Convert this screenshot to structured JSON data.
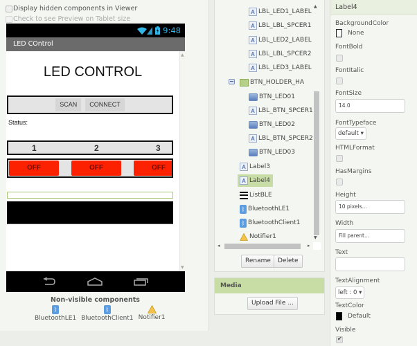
{
  "viewer": {
    "options": [
      {
        "label": "Display hidden components in Viewer",
        "checked": false,
        "enabled": true
      },
      {
        "label": "Check to see Preview on Tablet size",
        "checked": false,
        "enabled": false
      }
    ],
    "status_bar": {
      "time": "9:48",
      "icons": [
        "wifi-icon",
        "signal-icon",
        "battery-icon"
      ]
    },
    "screen_title": "LED COntrol",
    "app": {
      "title_label": "LED CONTROL",
      "scan_button": "SCAN",
      "connect_button": "CONNECT",
      "status_label": "Status:",
      "led_numbers": [
        "1",
        "2",
        "3"
      ],
      "led_buttons": [
        "OFF",
        "OFF",
        "OFF"
      ],
      "led_button_color": "#fc2100"
    },
    "nav_buttons": [
      "back-icon",
      "home-icon",
      "recents-icon"
    ],
    "non_visible": {
      "title": "Non-visible components",
      "items": [
        {
          "label": "BluetoothLE1",
          "icon": "bluetooth-icon"
        },
        {
          "label": "BluetoothClient1",
          "icon": "bluetooth-icon"
        },
        {
          "label": "Notifier1",
          "icon": "warning-icon"
        }
      ]
    }
  },
  "tree": {
    "items": [
      {
        "label": "LBL_LED1_LABEL",
        "icon": "label-icon"
      },
      {
        "label": "LBL_LBL_SPCER1",
        "icon": "label-icon"
      },
      {
        "label": "LBL_LED2_LABEL",
        "icon": "label-icon"
      },
      {
        "label": "LBL_LBL_SPCER2",
        "icon": "label-icon"
      },
      {
        "label": "LBL_LED3_LABEL",
        "icon": "label-icon"
      },
      {
        "label": "BTN_HOLDER_HA",
        "icon": "horizontal-arrangement-icon",
        "expanded": true
      },
      {
        "label": "BTN_LED01",
        "icon": "button-icon"
      },
      {
        "label": "LBL_BTN_SPCER1",
        "icon": "label-icon"
      },
      {
        "label": "BTN_LED02",
        "icon": "button-icon"
      },
      {
        "label": "LBL_BTN_SPCER2",
        "icon": "label-icon"
      },
      {
        "label": "BTN_LED03",
        "icon": "button-icon"
      },
      {
        "label": "Label3",
        "icon": "label-icon"
      },
      {
        "label": "Label4",
        "icon": "label-icon",
        "selected": true
      },
      {
        "label": "ListBLE",
        "icon": "listview-icon"
      },
      {
        "label": "BluetoothLE1",
        "icon": "bluetooth-icon"
      },
      {
        "label": "BluetoothClient1",
        "icon": "bluetooth-icon"
      },
      {
        "label": "Notifier1",
        "icon": "warning-icon"
      }
    ],
    "rename_button": "Rename",
    "delete_button": "Delete"
  },
  "media": {
    "title": "Media",
    "upload_button": "Upload File ..."
  },
  "properties": {
    "component": "Label4",
    "background_color": {
      "label": "BackgroundColor",
      "value": "None"
    },
    "font_bold": {
      "label": "FontBold",
      "checked": false
    },
    "font_italic": {
      "label": "FontItalic",
      "checked": false
    },
    "font_size": {
      "label": "FontSize",
      "value": "14.0"
    },
    "font_typeface": {
      "label": "FontTypeface",
      "value": "default ▾"
    },
    "html_format": {
      "label": "HTMLFormat",
      "checked": false
    },
    "has_margins": {
      "label": "HasMargins",
      "checked": false
    },
    "height": {
      "label": "Height",
      "value": "10 pixels..."
    },
    "width": {
      "label": "Width",
      "value": "Fill parent..."
    },
    "text": {
      "label": "Text",
      "value": ""
    },
    "text_alignment": {
      "label": "TextAlignment",
      "value": "left : 0 ▾"
    },
    "text_color": {
      "label": "TextColor",
      "value": "Default"
    },
    "visible": {
      "label": "Visible",
      "checked": true
    }
  }
}
